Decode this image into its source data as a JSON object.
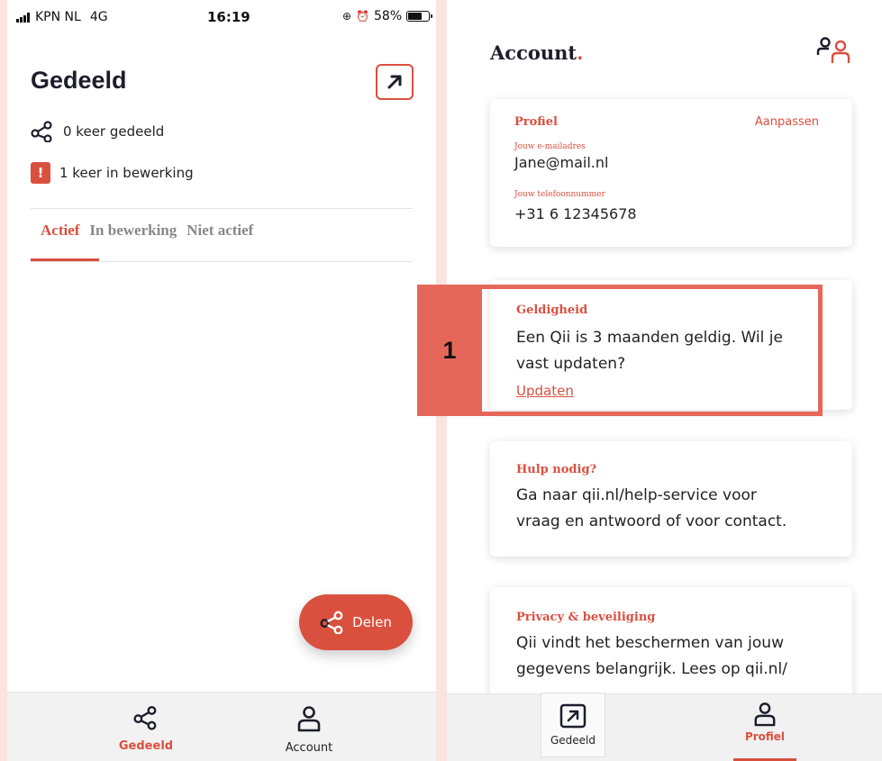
{
  "colors": {
    "accent": "#d9503f",
    "highlight": "#e5675a",
    "text": "#1d1d2b"
  },
  "left": {
    "status": {
      "carrier": "KPN NL",
      "network": "4G",
      "time": "16:19",
      "battery": "58%"
    },
    "title": "Gedeeld",
    "stats": {
      "shared": "0 keer gedeeld",
      "in_edit": "1 keer in bewerking",
      "warning_glyph": "!"
    },
    "tabs": [
      "Actief",
      "In bewerking",
      "Niet actief"
    ],
    "fab_label": "Delen",
    "nav": {
      "shared": "Gedeeld",
      "account": "Account"
    }
  },
  "right": {
    "title": "Account",
    "title_dot": ".",
    "profile": {
      "heading": "Profiel",
      "edit_link": "Aanpassen",
      "email_label": "Jouw e-mailadres",
      "email": "Jane@mail.nl",
      "phone_label": "Jouw telefoonnummer",
      "phone": "+31 6 12345678"
    },
    "validity": {
      "heading": "Geldigheid",
      "text_line1": "Een Qii is 3 maanden geldig. Wil je",
      "text_line2": "vast updaten?",
      "link": "Updaten"
    },
    "help": {
      "heading": "Hulp nodig?",
      "text_line1": "Ga naar qii.nl/help-service voor",
      "text_line2": "vraag en antwoord of voor contact."
    },
    "privacy": {
      "heading": "Privacy & beveiliging",
      "text_line1": "Qii vindt het beschermen van jouw",
      "text_line2": "gegevens belangrijk. Lees op qii.nl/"
    },
    "nav": {
      "shared": "Gedeeld",
      "profile": "Profiel"
    }
  },
  "annotation": {
    "number": "1"
  }
}
